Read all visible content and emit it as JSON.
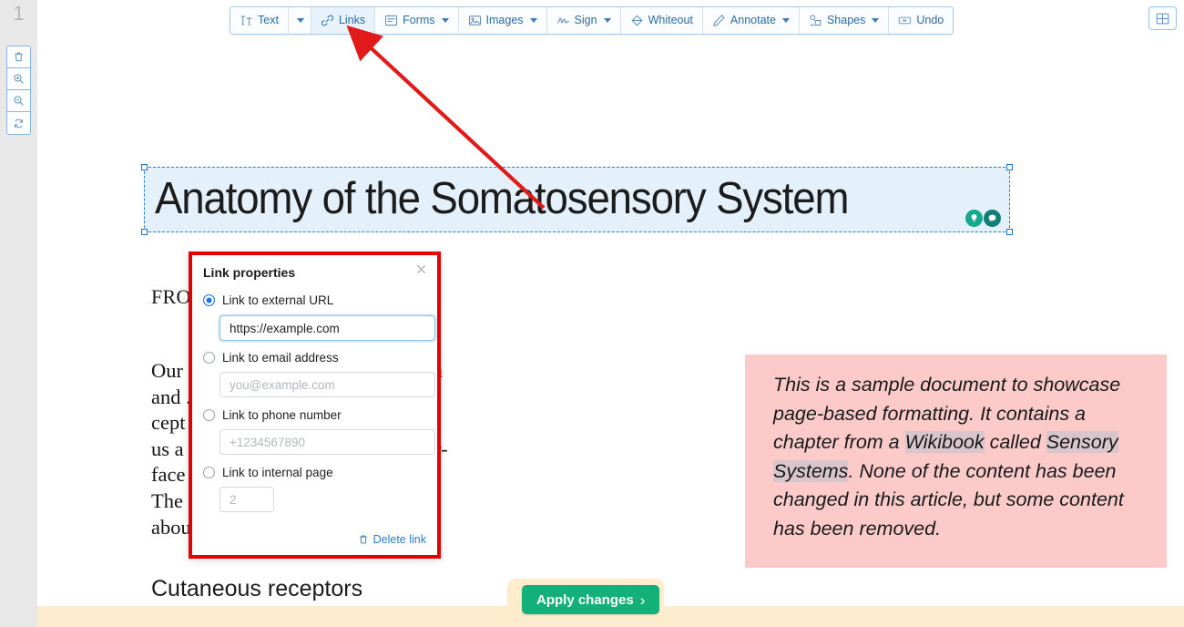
{
  "app": {
    "page_number": "1"
  },
  "left_rail": {
    "tools": [
      {
        "name": "delete-page",
        "icon": "trash-icon"
      },
      {
        "name": "zoom-in",
        "icon": "zoom-in-icon"
      },
      {
        "name": "zoom-out",
        "icon": "zoom-out-icon"
      },
      {
        "name": "rotate-page",
        "icon": "rotate-icon"
      }
    ]
  },
  "top_right": {
    "grid_view": "grid-view-icon"
  },
  "toolbar": {
    "items": [
      {
        "label": "Text",
        "icon": "text-icon",
        "caret": false,
        "active": false
      },
      {
        "label": "",
        "icon": "",
        "caret": true,
        "active": false
      },
      {
        "label": "Links",
        "icon": "link-icon",
        "caret": false,
        "active": true
      },
      {
        "label": "Forms",
        "icon": "forms-icon",
        "caret": true,
        "active": false
      },
      {
        "label": "Images",
        "icon": "image-icon",
        "caret": true,
        "active": false
      },
      {
        "label": "Sign",
        "icon": "signature-icon",
        "caret": true,
        "active": false
      },
      {
        "label": "Whiteout",
        "icon": "whiteout-icon",
        "caret": false,
        "active": false
      },
      {
        "label": "Annotate",
        "icon": "pen-icon",
        "caret": true,
        "active": false
      },
      {
        "label": "Shapes",
        "icon": "shapes-icon",
        "caret": true,
        "active": false
      },
      {
        "label": "Undo",
        "icon": "undo-icon",
        "caret": false,
        "active": false
      }
    ]
  },
  "document": {
    "title": "Anatomy of the Somatosensory System",
    "kicker": "FROM",
    "paragraph": "Our  ...  onsists of sensors in the skin\nand  ...  tendons, and joints. The re-\ncept  ...  led cutaneous receptors, tell\nus a  ...  (receptors), pressure and sur-\nface  ...  ors), and pain (nociceptors).\nThe  ...  d joints provide information\nabou  ...  tension, and joint angles.",
    "heading2": "Cutaneous receptors",
    "badges": [
      {
        "name": "idea-bulb-badge",
        "icon": "lightbulb-icon",
        "color": "#17a890"
      },
      {
        "name": "comment-badge",
        "icon": "chat-bubble-icon",
        "color": "#0f7f78"
      }
    ]
  },
  "callout": {
    "text_before_hl1": "This is a sample document to showcase page-based formatting. It contains a chapter from a ",
    "hl1": "Wikibook",
    "between": " called ",
    "hl2": "Sensory Systems",
    "text_after": ". None of the content has been changed in this article, but some content has been removed."
  },
  "apply": {
    "label": "Apply changes",
    "chevron": "›"
  },
  "dialog": {
    "title": "Link properties",
    "close_icon": "close-icon",
    "options": [
      {
        "label": "Link to external URL",
        "selected": true,
        "input_value": "https://example.com",
        "input_placeholder": ""
      },
      {
        "label": "Link to email address",
        "selected": false,
        "input_value": "",
        "input_placeholder": "you@example.com"
      },
      {
        "label": "Link to phone number",
        "selected": false,
        "input_value": "",
        "input_placeholder": "+1234567890"
      },
      {
        "label": "Link to internal page",
        "selected": false,
        "input_value": "",
        "input_placeholder": "2"
      }
    ],
    "delete_label": "Delete link",
    "delete_icon": "trash-icon"
  },
  "colors": {
    "highlight_border": "#e50000",
    "arrow": "#e11b1b",
    "accent_blue": "#2d6ca2",
    "apply_green": "#13b07a",
    "callout_pink": "#fccbc9",
    "strip_cream": "#fdeccd"
  }
}
